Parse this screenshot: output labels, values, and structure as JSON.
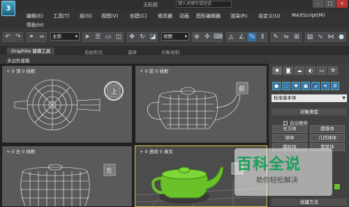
{
  "app": {
    "title": "无标题",
    "logo": "3",
    "search_placeholder": "键入关键字或短语"
  },
  "window_buttons": [
    "–",
    "□",
    "×"
  ],
  "menu": {
    "row1": [
      "编辑(E)",
      "工具(T)",
      "组(G)",
      "视图(V)",
      "创建(C)",
      "修改器",
      "动画",
      "图形编辑器",
      "渲染(R)",
      "自定义(U)",
      "MAXScript(M)"
    ],
    "row2": [
      "帮助(H)"
    ]
  },
  "toolbar": {
    "selection_filter": "全部",
    "coord_system": "视图",
    "icons": [
      "undo-icon",
      "redo-icon",
      "link-icon",
      "unlink-icon",
      "bind-space-warp-icon",
      "select-object-icon",
      "select-by-name-icon",
      "rect-selection-icon",
      "window-crossing-icon",
      "move-icon",
      "rotate-icon",
      "scale-icon",
      "pivot-icon",
      "select-manipulate-icon",
      "keyboard-shortcut-icon",
      "snap-icon",
      "angle-snap-icon",
      "percent-snap-icon",
      "spinner-snap-icon",
      "edit-named-selection-icon",
      "mirror-icon",
      "align-icon"
    ]
  },
  "ribbon": {
    "tabs": [
      "Graphite 建模工具",
      "自由形式",
      "选择",
      "对象绘制"
    ],
    "active_tab": "Graphite 建模工具",
    "subpanel": "多边形建模"
  },
  "viewports": [
    {
      "label": "+ 0 顶 0 线框",
      "name": "top"
    },
    {
      "label": "+ 0 前 0 线框",
      "name": "front"
    },
    {
      "label": "+ 0 左 0 线框",
      "name": "left"
    },
    {
      "label": "+ 0 透视 0 真实",
      "name": "perspective"
    }
  ],
  "command_panel": {
    "tabs": [
      "✱",
      "◙",
      "☁",
      "◐",
      "▭",
      "⚒"
    ],
    "category": "标准基本体",
    "rollout_object_type": "对象类型",
    "autogrid_label": "自动栅格",
    "buttons": [
      "长方体",
      "圆锥体",
      "球体",
      "几何球体",
      "圆柱体",
      "管状体"
    ],
    "rollout_creation": "创建方法",
    "color": "#6ac22a"
  },
  "watermark": {
    "title": "百科全说",
    "subtitle": "助你轻松解决"
  }
}
